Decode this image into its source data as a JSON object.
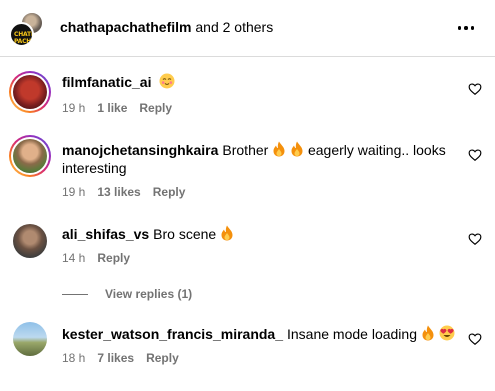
{
  "header": {
    "account": "chathapachathefilm",
    "others": "and 2 others",
    "logo_text": "CHATHA PACHA"
  },
  "comments": [
    {
      "username": "filmfanatic_ai",
      "text": "",
      "emoji": [
        "smiling-face-emoji"
      ],
      "time": "19 h",
      "likes": "1 like",
      "reply": "Reply"
    },
    {
      "username": "manojchetansinghkaira",
      "text": "Brother",
      "text2": "eagerly waiting.. looks",
      "text3": "interesting",
      "emoji": [
        "fire-emoji",
        "fire-emoji"
      ],
      "time": "19 h",
      "likes": "13 likes",
      "reply": "Reply"
    },
    {
      "username": "ali_shifas_vs",
      "text": "Bro scene",
      "emoji": [
        "fire-emoji"
      ],
      "time": "14 h",
      "reply": "Reply"
    },
    {
      "username": "kester_watson_francis_miranda_",
      "text": "Insane mode loading",
      "emoji": [
        "fire-emoji",
        "heart-eyes-emoji"
      ],
      "time": "18 h",
      "likes": "7 likes",
      "reply": "Reply"
    }
  ],
  "view_replies": "View replies (1)",
  "colors": {
    "secondary_text": "#737373",
    "divider": "#dbdbdb",
    "ring_start": "#feda75",
    "ring_end": "#4f5bd5"
  }
}
